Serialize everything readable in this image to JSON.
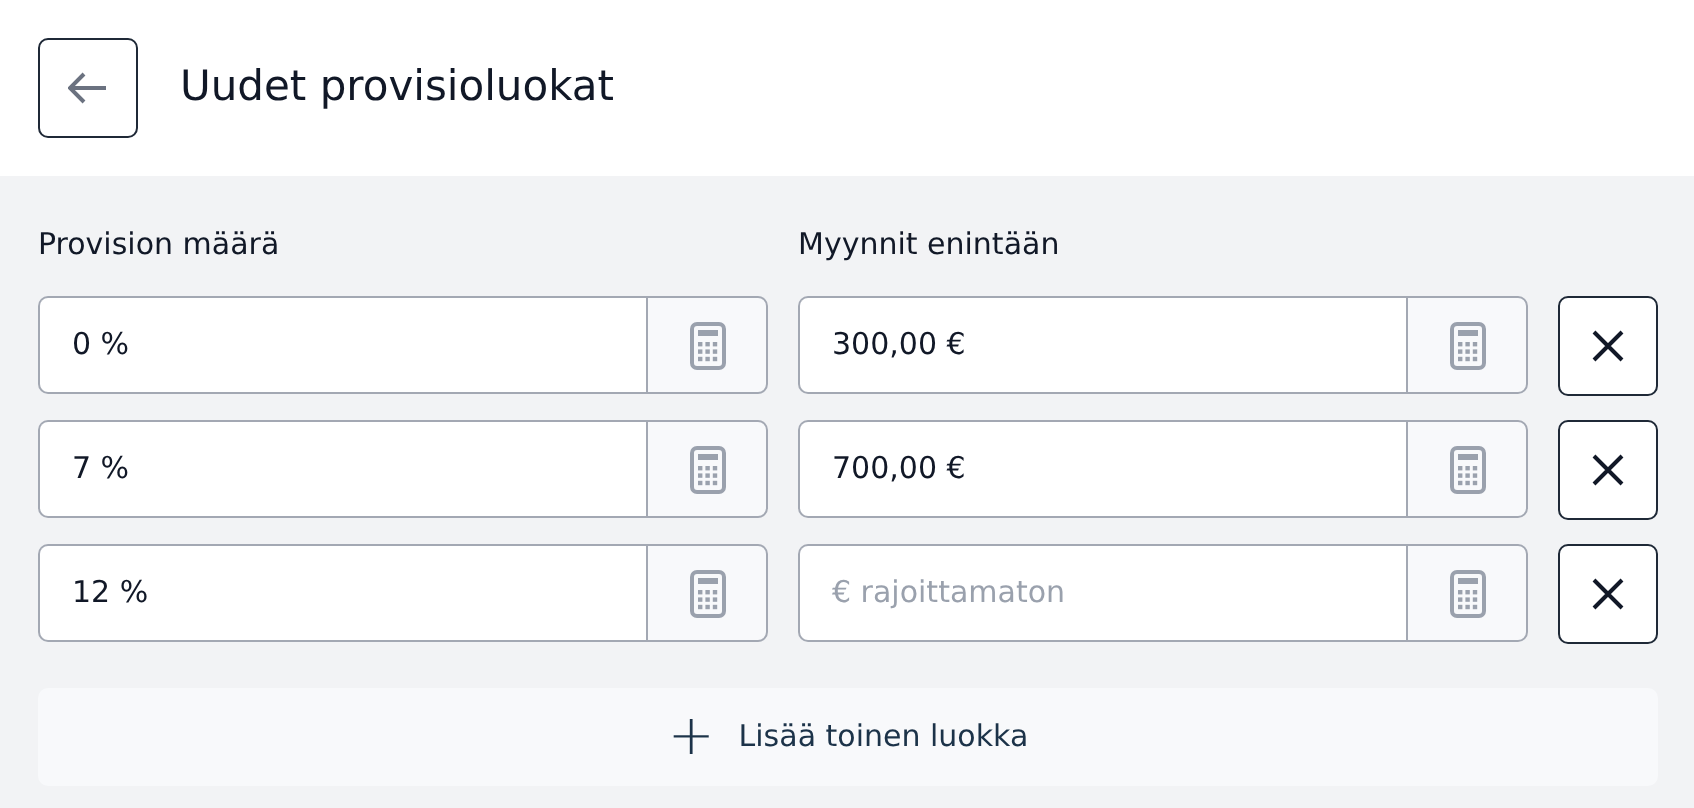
{
  "header": {
    "title": "Uudet provisioluokat"
  },
  "columns": [
    "Provision määrä",
    "Myynnit enintään"
  ],
  "rows": [
    {
      "rate": {
        "value": "0 %"
      },
      "limit": {
        "value": "300,00 €"
      }
    },
    {
      "rate": {
        "value": "7 %"
      },
      "limit": {
        "value": "700,00 €"
      }
    },
    {
      "rate": {
        "value": "12 %"
      },
      "limit": {
        "placeholder": "€ rajoittamaton"
      }
    }
  ],
  "add_button": {
    "icon": "+",
    "label": "Lisää toinen luokka"
  }
}
